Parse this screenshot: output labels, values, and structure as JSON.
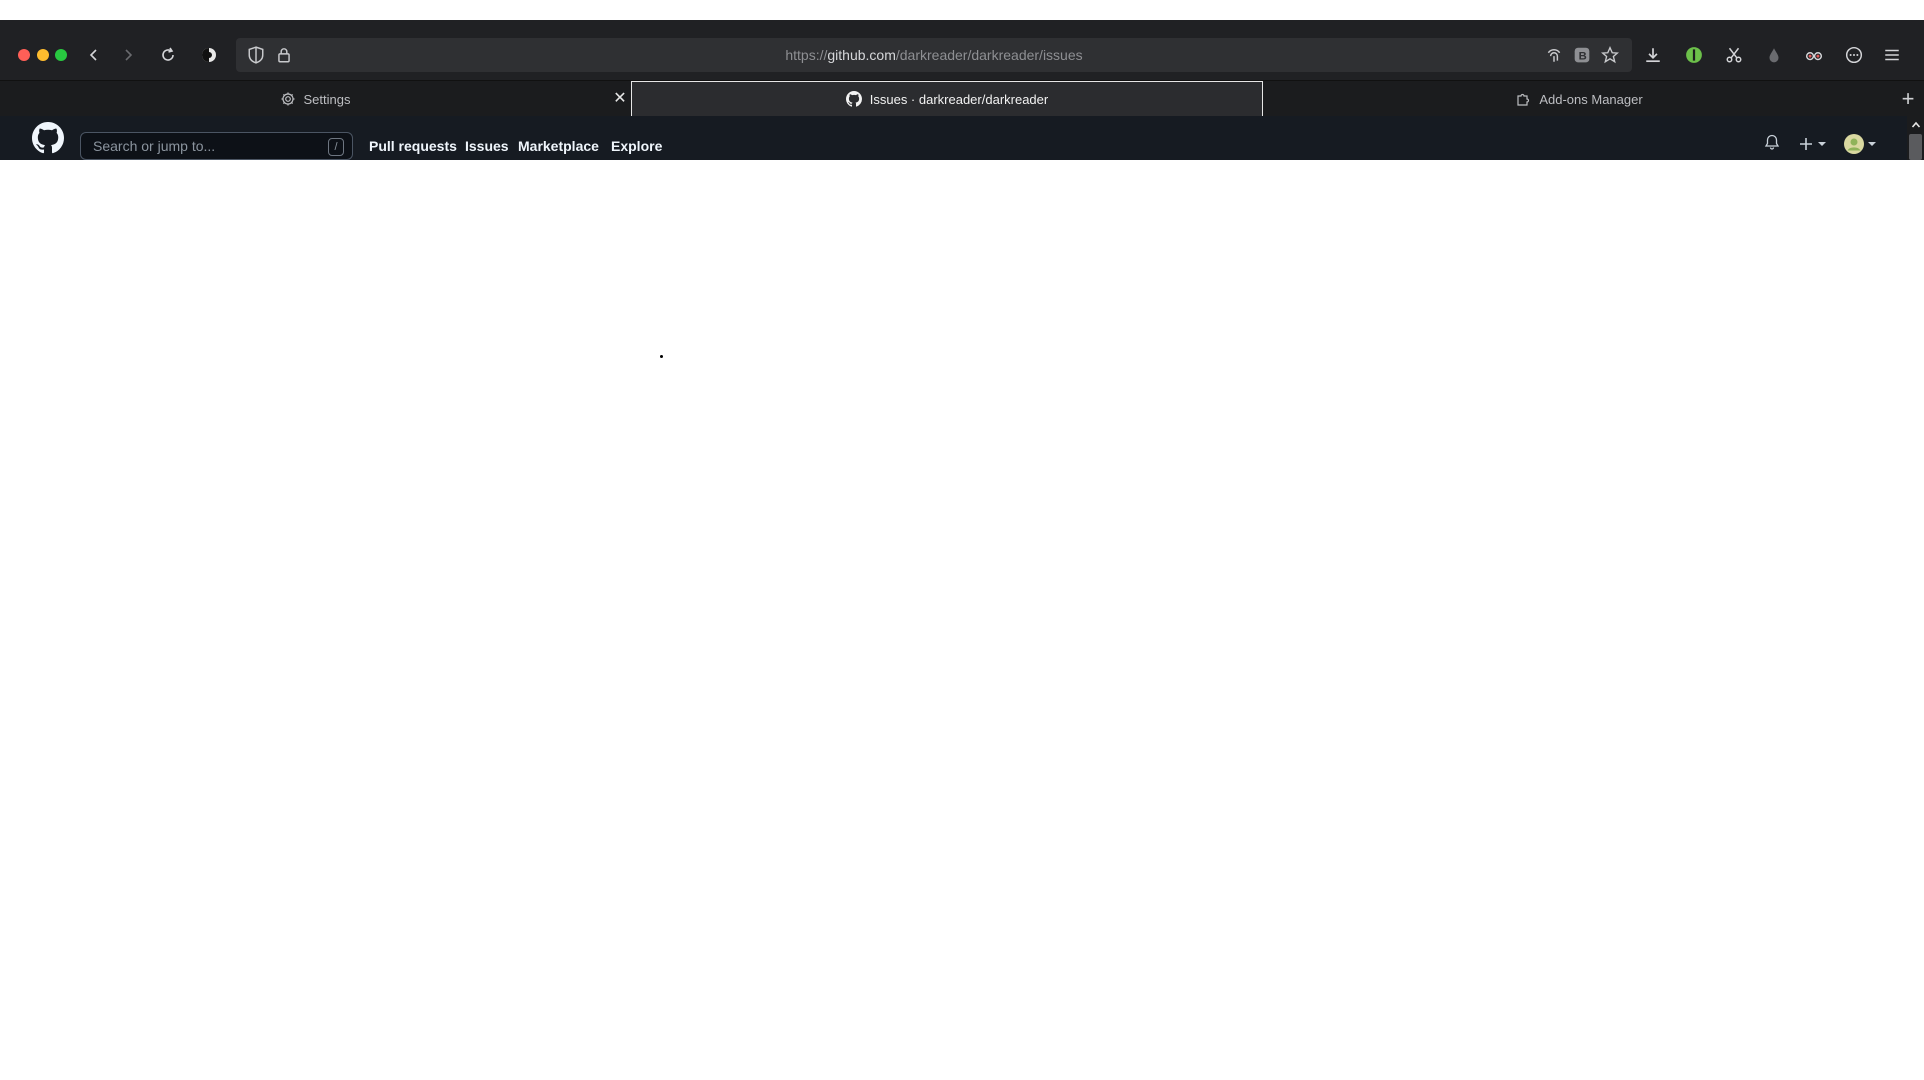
{
  "browser": {
    "url_scheme": "https://",
    "url_host": "github.com",
    "url_path": "/darkreader/darkreader/issues",
    "tabs": [
      {
        "label": "Settings"
      },
      {
        "label": "Issues · darkreader/darkreader"
      },
      {
        "label": "Add-ons Manager"
      }
    ],
    "traffic_colors": {
      "close": "#ff5f57",
      "minimize": "#febc2e",
      "maximize": "#28c840"
    }
  },
  "github": {
    "search_placeholder": "Search or jump to...",
    "search_shortcut": "/",
    "nav": [
      "Pull requests",
      "Issues",
      "Marketplace",
      "Explore"
    ],
    "header_bg": "#161b22"
  }
}
